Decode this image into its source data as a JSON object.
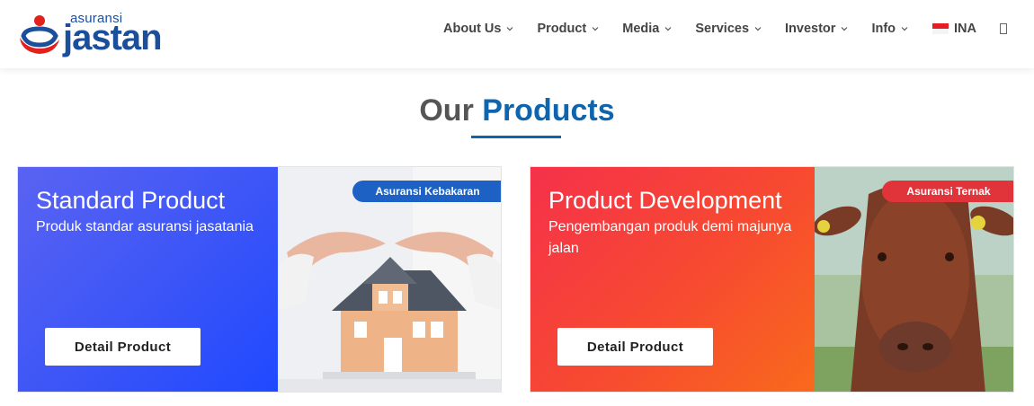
{
  "brand": {
    "small": "asuransi",
    "big": "jastan"
  },
  "nav": {
    "items": [
      {
        "label": "About Us"
      },
      {
        "label": "Product"
      },
      {
        "label": "Media"
      },
      {
        "label": "Services"
      },
      {
        "label": "Investor"
      },
      {
        "label": "Info"
      }
    ],
    "language": "INA"
  },
  "section": {
    "title_part1": "Our",
    "title_part2": "Products"
  },
  "cards": [
    {
      "title": "Standard Product",
      "subtitle": "Produk standar asuransi jasatania",
      "button": "Detail Product",
      "badge": "Asuransi Kebakaran",
      "gradient": [
        "#5a63f2",
        "#1f49ff"
      ],
      "badge_color": "#1d61c4"
    },
    {
      "title": "Product Development",
      "subtitle": "Pengembangan produk demi majunya jalan",
      "button": "Detail Product",
      "badge": "Asuransi Ternak",
      "gradient": [
        "#f5314a",
        "#f96a1c"
      ],
      "badge_color": "#e0343a"
    }
  ],
  "colors": {
    "accent": "#0e64ad",
    "title_gray": "#555555"
  }
}
